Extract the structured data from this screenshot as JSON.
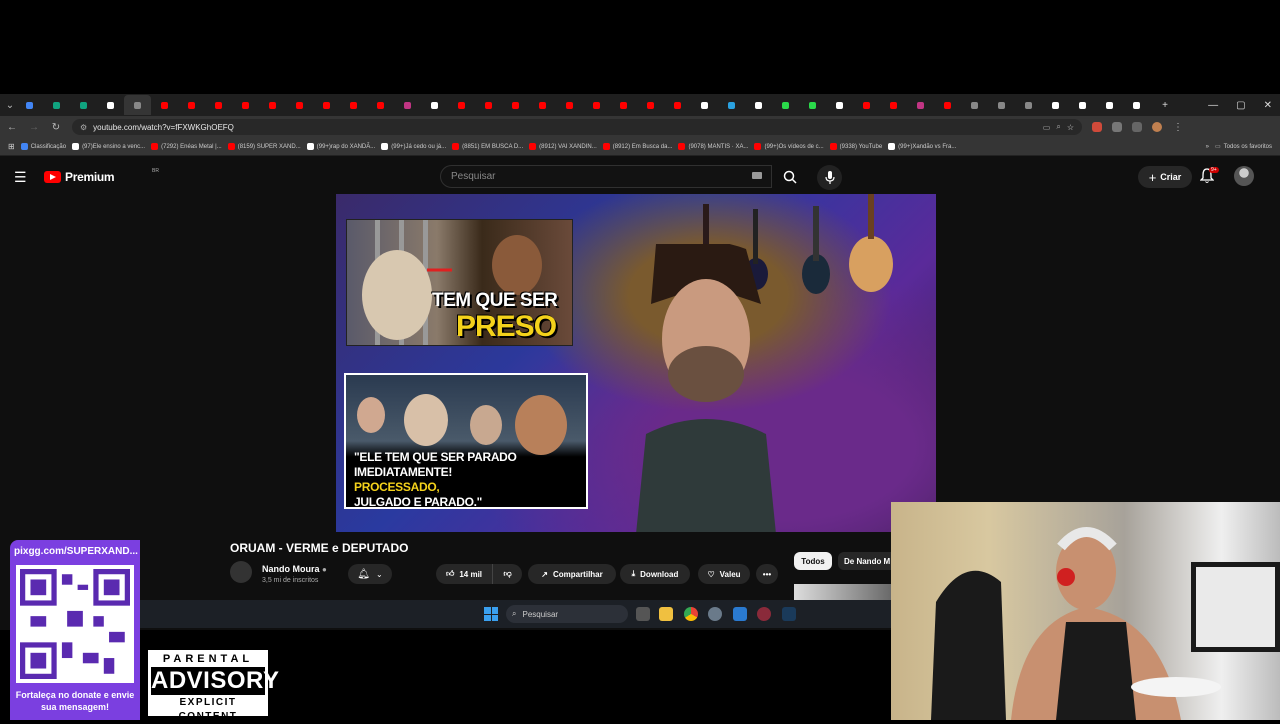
{
  "browser": {
    "url": "youtube.com/watch?v=fFXWKGhOEFQ",
    "tabs": [
      {
        "icon": "youtube",
        "color": "#ff0000"
      },
      {
        "icon": "chatgpt",
        "color": "#10a37f"
      },
      {
        "icon": "generic",
        "color": "#4285f4"
      },
      {
        "icon": "tiktok",
        "color": "#ffffff"
      },
      {
        "icon": "active",
        "color": "#ffffff",
        "active": true
      }
    ],
    "bookmarks": [
      "Classificação",
      "(97)Ele ensino a venc...",
      "(7292) Enéas Metal |...",
      "(8159) SUPER XAND...",
      "(99+)rap do XANDÃ...",
      "(99+)Já cedo ou já...",
      "(8851) EM BUSCA D...",
      "(8912) VAI XANDIN...",
      "(8912) Em Busca da...",
      "(9078) MANTIS · XA...",
      "(99+)Os vídeos de c...",
      "(9338) YouTube",
      "(99+)Xandão vs Fra..."
    ],
    "all_bookmarks_label": "Todos os favoritos"
  },
  "youtube": {
    "logo_text": "Premium",
    "logo_country": "BR",
    "search_placeholder": "Pesquisar",
    "create_label": "Criar",
    "notif_badge": "9+"
  },
  "video": {
    "overlay1_line1": "TEM QUE SER",
    "overlay1_line2": "PRESO",
    "overlay2_line1": "\"ELE TEM QUE SER PARADO",
    "overlay2_line2_a": "IMEDIATAMENTE! ",
    "overlay2_line2_b": "PROCESSADO,",
    "overlay2_line3": "JULGADO E PARADO.\"",
    "title": "ORUAM - VERME e DEPUTADO",
    "channel_name": "Nando Moura",
    "channel_subs": "3,5 mi de inscritos",
    "likes": "14 mil",
    "share_label": "Compartilhar",
    "download_label": "Download",
    "thanks_label": "Valeu"
  },
  "sidebar_chips": [
    "Todos",
    "De Nando M"
  ],
  "taskbar": {
    "search_placeholder": "Pesquisar"
  },
  "stream_overlay": {
    "pix_url": "pixgg.com/SUPERXAND...",
    "pix_caption": "Fortaleça no donate e envie sua mensagem!",
    "advisory_top": "PARENTAL",
    "advisory_mid": "ADVISORY",
    "advisory_bottom": "EXPLICIT CONTENT"
  }
}
